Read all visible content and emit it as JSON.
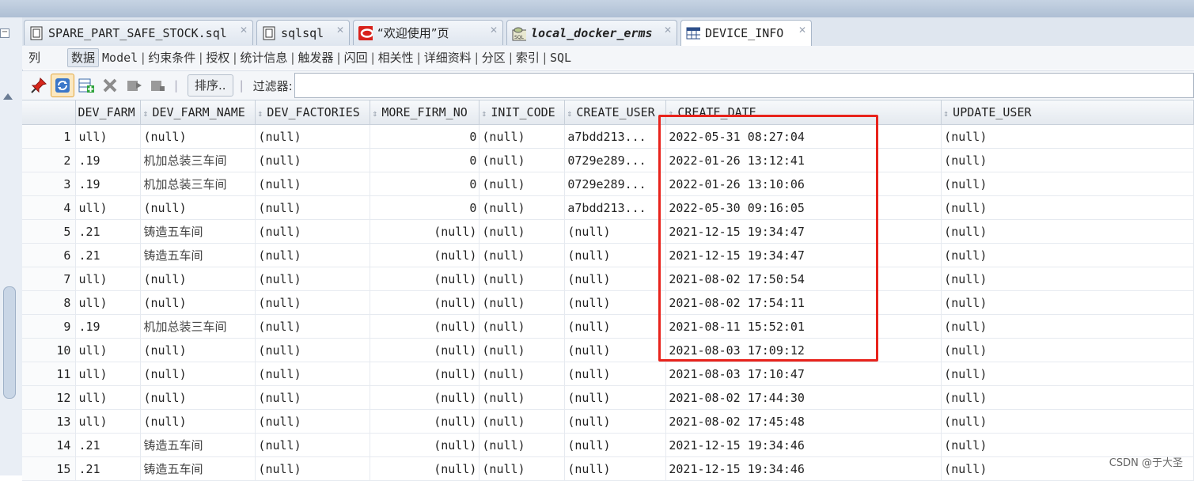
{
  "tabs": [
    {
      "label": "SPARE_PART_SAFE_STOCK.sql",
      "icon": "sql-file-icon"
    },
    {
      "label": "sqlsql",
      "icon": "sql-file-icon"
    },
    {
      "label": "“欢迎使用”页",
      "icon": "oracle-icon"
    },
    {
      "label": "local_docker_erms",
      "icon": "sql-worksheet-icon"
    },
    {
      "label": "DEVICE_INFO",
      "icon": "table-icon"
    }
  ],
  "subtabs": [
    "列",
    "数据",
    "Model",
    "约束条件",
    "授权",
    "统计信息",
    "触发器",
    "闪回",
    "相关性",
    "详细资料",
    "分区",
    "索引",
    "SQL"
  ],
  "toolbar": {
    "sort_label": "排序..",
    "filter_label": "过滤器:",
    "filter_value": ""
  },
  "columns": [
    "DEV_FARM",
    "DEV_FARM_NAME",
    "DEV_FACTORIES",
    "MORE_FIRM_NO",
    "INIT_CODE",
    "CREATE_USER",
    "CREATE_DATE",
    "UPDATE_USER"
  ],
  "rows": [
    [
      "1",
      "ull)",
      "(null)",
      "(null)",
      "0",
      "(null)",
      "a7bdd213...",
      "2022-05-31 08:27:04",
      "(null)"
    ],
    [
      "2",
      ".19",
      "机加总装三车间",
      "(null)",
      "0",
      "(null)",
      "0729e289...",
      "2022-01-26 13:12:41",
      "(null)"
    ],
    [
      "3",
      ".19",
      "机加总装三车间",
      "(null)",
      "0",
      "(null)",
      "0729e289...",
      "2022-01-26 13:10:06",
      "(null)"
    ],
    [
      "4",
      "ull)",
      "(null)",
      "(null)",
      "0",
      "(null)",
      "a7bdd213...",
      "2022-05-30 09:16:05",
      "(null)"
    ],
    [
      "5",
      ".21",
      "铸造五车间",
      "(null)",
      "(null)",
      "(null)",
      "(null)",
      "2021-12-15 19:34:47",
      "(null)"
    ],
    [
      "6",
      ".21",
      "铸造五车间",
      "(null)",
      "(null)",
      "(null)",
      "(null)",
      "2021-12-15 19:34:47",
      "(null)"
    ],
    [
      "7",
      "ull)",
      "(null)",
      "(null)",
      "(null)",
      "(null)",
      "(null)",
      "2021-08-02 17:50:54",
      "(null)"
    ],
    [
      "8",
      "ull)",
      "(null)",
      "(null)",
      "(null)",
      "(null)",
      "(null)",
      "2021-08-02 17:54:11",
      "(null)"
    ],
    [
      "9",
      ".19",
      "机加总装三车间",
      "(null)",
      "(null)",
      "(null)",
      "(null)",
      "2021-08-11 15:52:01",
      "(null)"
    ],
    [
      "10",
      "ull)",
      "(null)",
      "(null)",
      "(null)",
      "(null)",
      "(null)",
      "2021-08-03 17:09:12",
      "(null)"
    ],
    [
      "11",
      "ull)",
      "(null)",
      "(null)",
      "(null)",
      "(null)",
      "(null)",
      "2021-08-03 17:10:47",
      "(null)"
    ],
    [
      "12",
      "ull)",
      "(null)",
      "(null)",
      "(null)",
      "(null)",
      "(null)",
      "2021-08-02 17:44:30",
      "(null)"
    ],
    [
      "13",
      "ull)",
      "(null)",
      "(null)",
      "(null)",
      "(null)",
      "(null)",
      "2021-08-02 17:45:48",
      "(null)"
    ],
    [
      "14",
      ".21",
      "铸造五车间",
      "(null)",
      "(null)",
      "(null)",
      "(null)",
      "2021-12-15 19:34:46",
      "(null)"
    ],
    [
      "15",
      ".21",
      "铸造五车间",
      "(null)",
      "(null)",
      "(null)",
      "(null)",
      "2021-12-15 19:34:46",
      "(null)"
    ]
  ],
  "watermark": "CSDN @于大圣",
  "colors": {
    "highlight_box": "#e8231c",
    "selected_tool": "#fbe8c1"
  }
}
